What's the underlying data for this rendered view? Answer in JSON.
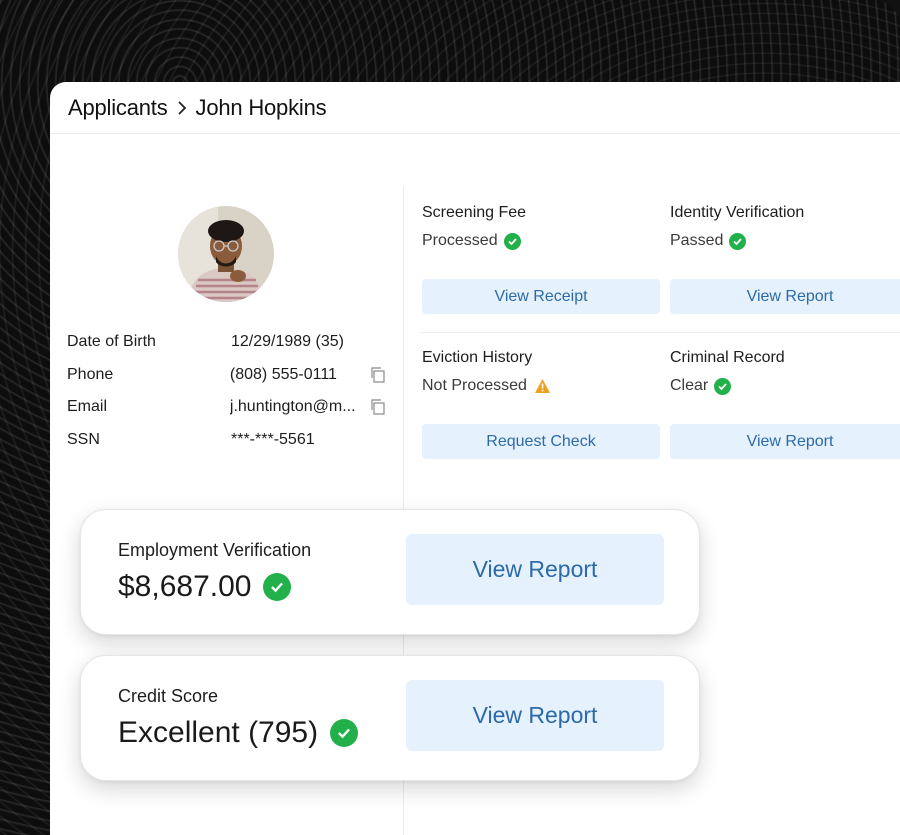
{
  "breadcrumb": {
    "root": "Applicants",
    "current": "John Hopkins"
  },
  "applicant": {
    "rows": [
      {
        "label": "Date of Birth",
        "value": "12/29/1989 (35)"
      },
      {
        "label": "Phone",
        "value": "(808) 555-0111"
      },
      {
        "label": "Email",
        "value": "j.huntington@m..."
      },
      {
        "label": "SSN",
        "value": "***-***-5561"
      }
    ]
  },
  "checks": {
    "screening_fee": {
      "title": "Screening Fee",
      "status": "Processed",
      "status_icon": "check-circle-icon",
      "button": "View Receipt"
    },
    "identity": {
      "title": "Identity Verification",
      "status": "Passed",
      "status_icon": "check-circle-icon",
      "button": "View Report"
    },
    "eviction": {
      "title": "Eviction History",
      "status": "Not Processed",
      "status_icon": "warning-icon",
      "button": "Request Check"
    },
    "criminal": {
      "title": "Criminal Record",
      "status": "Clear",
      "status_icon": "check-circle-icon",
      "button": "View Report"
    }
  },
  "highlights": {
    "employment": {
      "title": "Employment Verification",
      "value": "$8,687.00",
      "button": "View Report"
    },
    "credit": {
      "title": "Credit Score",
      "value": "Excellent (795)",
      "button": "View Report"
    }
  },
  "colors": {
    "success": "#22b04b",
    "warning": "#f0a020",
    "button_bg": "#e5f1fc",
    "button_text": "#2c6aa8"
  }
}
